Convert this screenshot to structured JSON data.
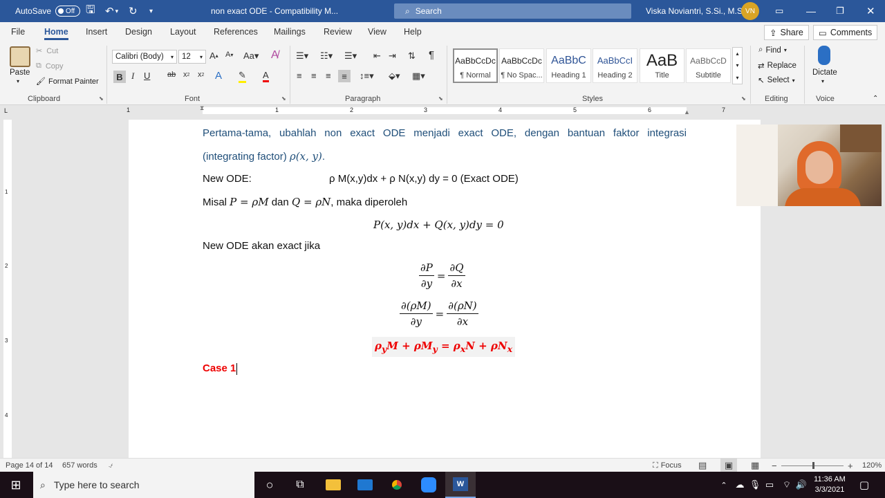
{
  "titlebar": {
    "autosave_label": "AutoSave",
    "autosave_state": "Off",
    "document_title": "non exact ODE  -  Compatibility M...",
    "search_placeholder": "Search",
    "user_name": "Viska Noviantri, S.Si., M.Si.",
    "user_initials": "VN"
  },
  "ribbon_tabs": [
    "File",
    "Home",
    "Insert",
    "Design",
    "Layout",
    "References",
    "Mailings",
    "Review",
    "View",
    "Help"
  ],
  "share_label": "Share",
  "comments_label": "Comments",
  "clipboard": {
    "paste": "Paste",
    "cut": "Cut",
    "copy": "Copy",
    "format_painter": "Format Painter",
    "group_label": "Clipboard"
  },
  "font": {
    "name": "Calibri (Body)",
    "size": "12",
    "group_label": "Font"
  },
  "paragraph": {
    "group_label": "Paragraph"
  },
  "styles": {
    "items": [
      {
        "preview": "AaBbCcDc",
        "name": "¶ Normal"
      },
      {
        "preview": "AaBbCcDc",
        "name": "¶ No Spac..."
      },
      {
        "preview": "AaBbC",
        "name": "Heading 1"
      },
      {
        "preview": "AaBbCcI",
        "name": "Heading 2"
      },
      {
        "preview": "AaB",
        "name": "Title"
      },
      {
        "preview": "AaBbCcD",
        "name": "Subtitle"
      }
    ],
    "group_label": "Styles"
  },
  "editing": {
    "find": "Find",
    "replace": "Replace",
    "select": "Select",
    "group_label": "Editing"
  },
  "voice": {
    "dictate": "Dictate",
    "group_label": "Voice"
  },
  "ruler_numbers": [
    "1",
    "1",
    "2",
    "3",
    "4",
    "5",
    "6",
    "7"
  ],
  "vruler_numbers": [
    "1",
    "2",
    "3",
    "4"
  ],
  "document": {
    "para1_line1": "Pertama-tama, ubahlah non exact ODE menjadi exact ODE, dengan bantuan faktor integrasi",
    "para1_line2_text": "(integrating factor) ",
    "para1_line2_math": "ρ(x, y)",
    "para1_line2_end": ".",
    "new_ode_label": "New ODE:",
    "new_ode_eq": "ρ M(x,y)dx + ρ N(x,y) dy = 0 (Exact ODE)",
    "misal_prefix": "Misal ",
    "misal_eq1": "P = ρM",
    "misal_dan": " dan ",
    "misal_eq2": "Q = ρN",
    "misal_suffix": ", maka diperoleh",
    "eq_pq": "P(x, y)dx + Q(x, y)dy = 0",
    "exact_if": "New ODE akan exact jika",
    "frac1_num_l": "∂P",
    "frac1_den_l": "∂y",
    "frac1_num_r": "∂Q",
    "frac1_den_r": "∂x",
    "frac2_num_l": "∂(ρM)",
    "frac2_den_l": "∂y",
    "frac2_num_r": "∂(ρN)",
    "frac2_den_r": "∂x",
    "equals": "=",
    "red_eq_rho": "ρ",
    "red_eq_y": "y",
    "red_eq_M": "M + ρM",
    "red_eq_y2": "y",
    "red_eq_mid": " = ρ",
    "red_eq_x": "x",
    "red_eq_N": "N + ρN",
    "red_eq_x2": "x",
    "case_label": "Case 1"
  },
  "statusbar": {
    "page": "Page 14 of 14",
    "words": "657 words",
    "focus": "Focus",
    "zoom": "120%"
  },
  "taskbar": {
    "search_placeholder": "Type here to search",
    "time": "11:36 AM",
    "date": "3/3/2021"
  },
  "colors": {
    "word_blue": "#2b579a",
    "doc_blue_text": "#1f4e79",
    "red_text": "#e00000"
  }
}
